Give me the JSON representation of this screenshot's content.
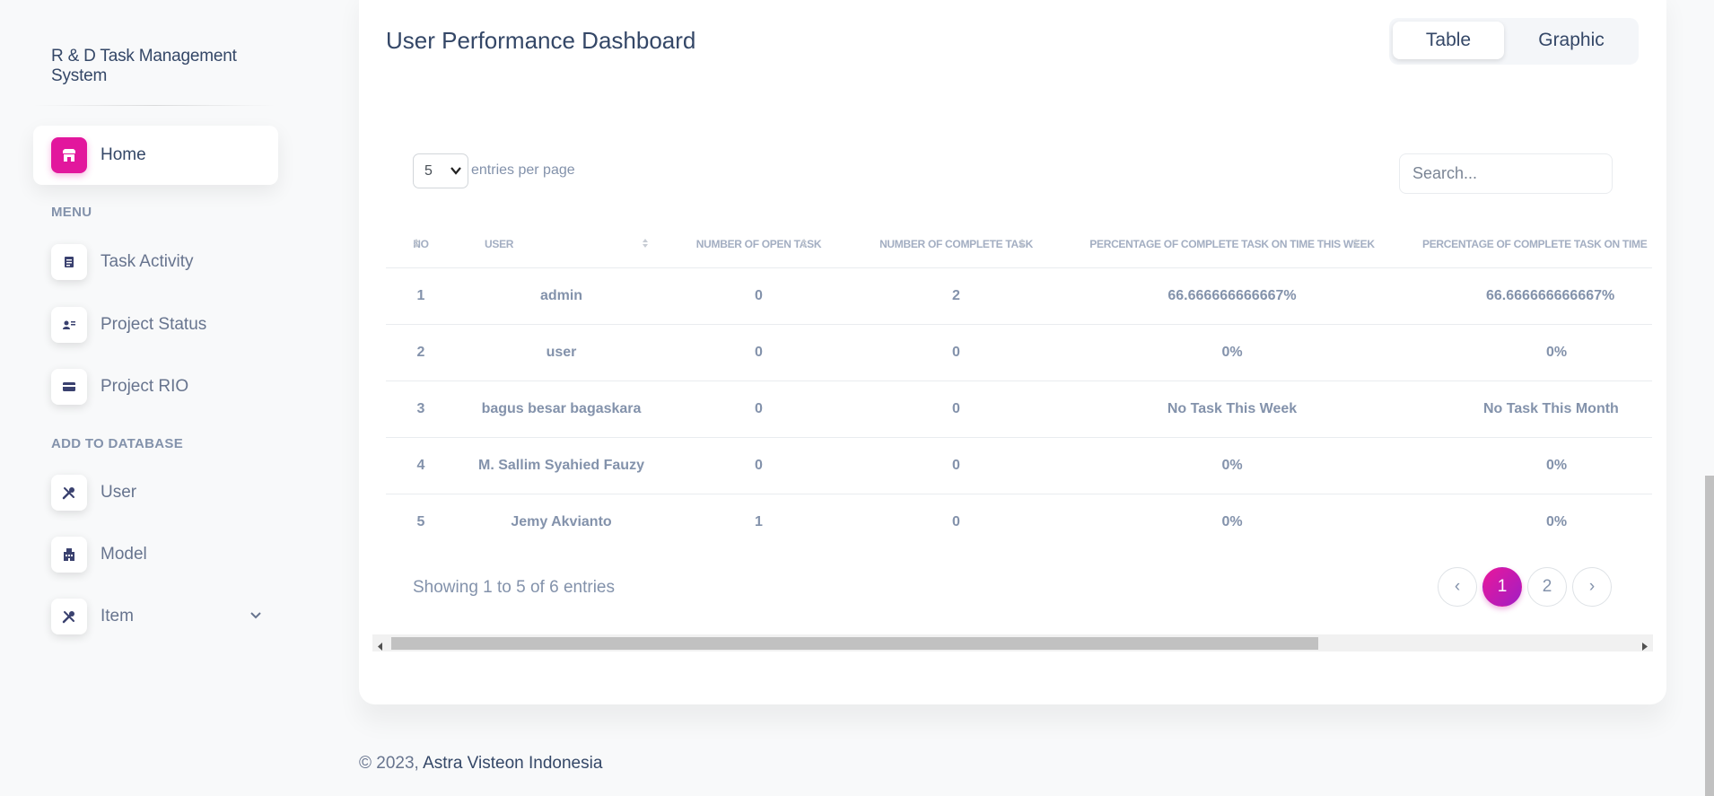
{
  "sidebar": {
    "brand": "R & D Task Management System",
    "home_label": "Home",
    "menu_heading": "MENU",
    "menu_items": [
      {
        "label": "Task Activity",
        "icon": "document-icon"
      },
      {
        "label": "Project Status",
        "icon": "id-card-icon"
      },
      {
        "label": "Project RIO",
        "icon": "credit-card-icon"
      }
    ],
    "db_heading": "ADD TO DATABASE",
    "db_items": [
      {
        "label": "User",
        "icon": "tools-icon"
      },
      {
        "label": "Model",
        "icon": "building-icon"
      },
      {
        "label": "Item",
        "icon": "tools-icon"
      }
    ]
  },
  "main": {
    "title": "User Performance Dashboard",
    "view_toggle": {
      "table": "Table",
      "graphic": "Graphic",
      "selected": "Table"
    },
    "entries_value": "5",
    "entries_label": "entries per page",
    "search_placeholder": "Search...",
    "table": {
      "headers": [
        "NO",
        "USER",
        "NUMBER OF OPEN TASK",
        "NUMBER OF COMPLETE TASK",
        "PERCENTAGE OF COMPLETE TASK ON TIME THIS WEEK",
        "PERCENTAGE OF COMPLETE TASK ON TIME"
      ],
      "rows": [
        [
          "1",
          "admin",
          "0",
          "2",
          "66.666666666667%",
          "66.666666666667%"
        ],
        [
          "2",
          "user",
          "0",
          "0",
          "0%",
          "0%"
        ],
        [
          "3",
          "bagus besar bagaskara",
          "0",
          "0",
          "No Task This Week",
          "No Task This Month"
        ],
        [
          "4",
          "M. Sallim Syahied Fauzy",
          "0",
          "0",
          "0%",
          "0%"
        ],
        [
          "5",
          "Jemy Akvianto",
          "1",
          "0",
          "0%",
          "0%"
        ]
      ]
    },
    "info": "Showing 1 to 5 of 6 entries",
    "pagination": {
      "prev": "‹",
      "pages": [
        "1",
        "2"
      ],
      "current": "1",
      "next": "›"
    }
  },
  "footer": {
    "copyright": "© 2023,",
    "company": "Astra Visteon Indonesia"
  },
  "colors": {
    "accent": "#e2179d",
    "text": "#344767",
    "muted": "#8392ab"
  }
}
